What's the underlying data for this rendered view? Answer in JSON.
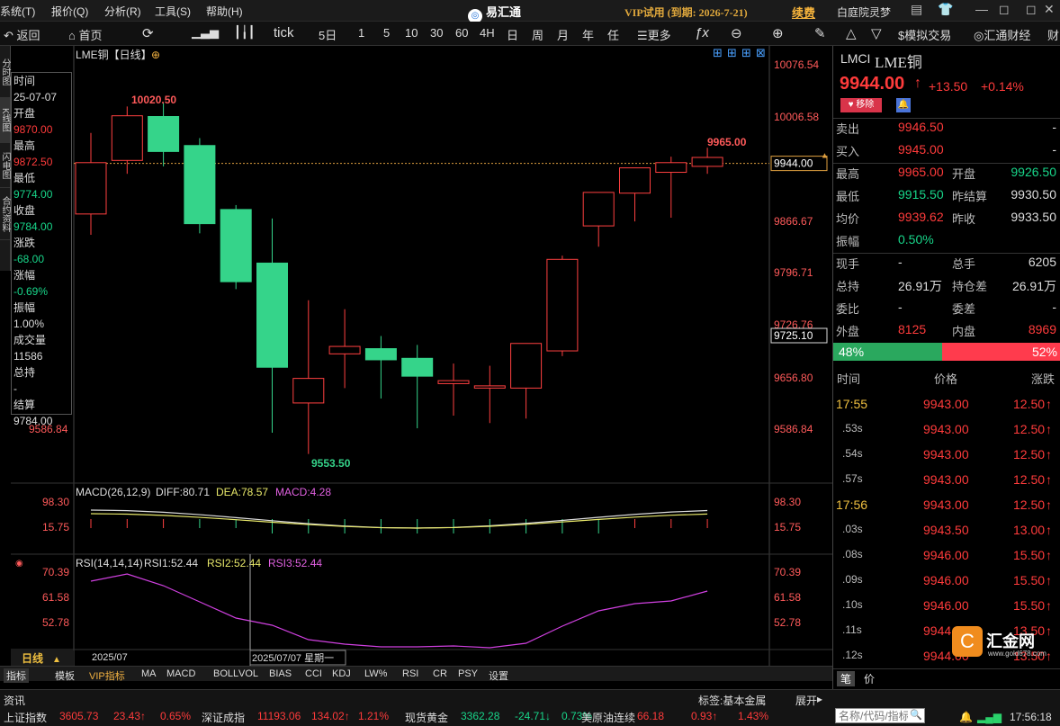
{
  "menu": {
    "items": [
      "系统(T)",
      "报价(Q)",
      "分析(R)",
      "工具(S)",
      "帮助(H)"
    ],
    "app_name": "易汇通",
    "vip_text": "VIP试用 (到期: 2026-7-21)",
    "renew": "续费",
    "user": "白庭院灵梦"
  },
  "toolbar": {
    "back": "返回",
    "home": "首页",
    "tick": "tick",
    "periods": [
      "5日",
      "1",
      "5",
      "10",
      "30",
      "60",
      "4H",
      "日",
      "周",
      "月",
      "年",
      "任"
    ],
    "more": "更多"
  },
  "right_toolbar": {
    "sim": "模拟交易",
    "news": "汇通财经",
    "more": "财"
  },
  "left_side": [
    "分时图",
    "K线图",
    "闪电图",
    "合约资料"
  ],
  "chart": {
    "title": "LME铜【日线】",
    "price_labels": [
      "10076.54",
      "10006.58",
      "9866.67",
      "9796.71",
      "9726.76",
      "9656.80",
      "9586.84"
    ],
    "left_low_label": "9586.84",
    "current_tag": "9944.00",
    "hover_tag": "9725.10",
    "max_label": "10020.50",
    "min_label": "9553.50",
    "recent_high_label": "9965.00"
  },
  "info_panel": [
    {
      "label": "时间",
      "value": "25-07-07",
      "vc": "#ddd"
    },
    {
      "label": "开盘",
      "value": "9870.00",
      "vc": "#ff3b3b"
    },
    {
      "label": "最高",
      "value": "9872.50",
      "vc": "#ff3b3b"
    },
    {
      "label": "最低",
      "value": "9774.00",
      "vc": "#18d68a"
    },
    {
      "label": "收盘",
      "value": "9784.00",
      "vc": "#18d68a"
    },
    {
      "label": "涨跌",
      "value": "-68.00",
      "vc": "#18d68a"
    },
    {
      "label": "涨幅",
      "value": "-0.69%",
      "vc": "#18d68a"
    },
    {
      "label": "振幅",
      "value": "1.00%",
      "vc": "#ddd"
    },
    {
      "label": "成交量",
      "value": "11586",
      "vc": "#ddd"
    },
    {
      "label": "总持",
      "value": "-",
      "vc": "#ddd"
    },
    {
      "label": "结算",
      "value": "9784.00",
      "vc": "#ddd"
    }
  ],
  "macd": {
    "title": "MACD(26,12,9)",
    "diff": "DIFF:80.71",
    "dea": "DEA:78.57",
    "macd": "MACD:4.28",
    "labels": [
      "98.30",
      "15.75"
    ]
  },
  "rsi": {
    "title": "RSI(14,14,14)",
    "rsi1": "RSI1:52.44",
    "rsi2": "RSI2:52.44",
    "rsi3": "RSI3:52.44",
    "labels": [
      "70.39",
      "61.58",
      "52.78"
    ]
  },
  "x_axis": {
    "period": "日线",
    "month": "2025/07",
    "cursor": "2025/07/07 星期一"
  },
  "bottom_tabs": [
    "指标",
    "模板",
    "VIP指标",
    "MA",
    "MACD",
    "BOLL",
    "VOL",
    "BIAS",
    "CCI",
    "KDJ",
    "LW%",
    "RSI",
    "CR",
    "PSY",
    "设置"
  ],
  "quote": {
    "symbol": "LMCI",
    "name": "LME铜",
    "price": "9944.00",
    "change": "+13.50",
    "pct": "+0.14%",
    "remove": "移除",
    "rows": [
      {
        "l1": "卖出",
        "v1": "9946.50",
        "c1": "red",
        "l2": "",
        "v2": "-",
        "c2": "wht"
      },
      {
        "l1": "买入",
        "v1": "9945.00",
        "c1": "red",
        "l2": "",
        "v2": "-",
        "c2": "wht"
      },
      {
        "l1": "最高",
        "v1": "9965.00",
        "c1": "red",
        "l2": "开盘",
        "v2": "9926.50",
        "c2": "grn"
      },
      {
        "l1": "最低",
        "v1": "9915.50",
        "c1": "grn",
        "l2": "昨结算",
        "v2": "9930.50",
        "c2": "wht"
      },
      {
        "l1": "均价",
        "v1": "9939.62",
        "c1": "red",
        "l2": "昨收",
        "v2": "9933.50",
        "c2": "wht"
      },
      {
        "l1": "振幅",
        "v1": "0.50%",
        "c1": "grn",
        "l2": "",
        "v2": "",
        "c2": "wht"
      },
      {
        "l1": "现手",
        "v1": "-",
        "c1": "wht",
        "l2": "总手",
        "v2": "6205",
        "c2": "wht"
      },
      {
        "l1": "总持",
        "v1": "26.91万",
        "c1": "wht",
        "l2": "持仓差",
        "v2": "26.91万",
        "c2": "wht"
      },
      {
        "l1": "委比",
        "v1": "-",
        "c1": "wht",
        "l2": "委差",
        "v2": "-",
        "c2": "wht"
      },
      {
        "l1": "外盘",
        "v1": "8125",
        "c1": "red",
        "l2": "内盘",
        "v2": "8969",
        "c2": "red"
      }
    ],
    "outer_pct": "48%",
    "inner_pct": "52%",
    "outer_frac": 0.48
  },
  "ticks": {
    "headers": [
      "时间",
      "价格",
      "涨跌"
    ],
    "rows": [
      {
        "t": "17:55",
        "p": "9943.00",
        "c": "12.50"
      },
      {
        "t": ".53s",
        "p": "9943.00",
        "c": "12.50"
      },
      {
        "t": ".54s",
        "p": "9943.00",
        "c": "12.50"
      },
      {
        "t": ".57s",
        "p": "9943.00",
        "c": "12.50"
      },
      {
        "t": "17:56",
        "p": "9943.00",
        "c": "12.50"
      },
      {
        "t": ".03s",
        "p": "9943.50",
        "c": "13.00"
      },
      {
        "t": ".08s",
        "p": "9946.00",
        "c": "15.50"
      },
      {
        "t": ".09s",
        "p": "9946.00",
        "c": "15.50"
      },
      {
        "t": ".10s",
        "p": "9946.00",
        "c": "15.50"
      },
      {
        "t": ".11s",
        "p": "9944.00",
        "c": "13.50"
      },
      {
        "t": ".12s",
        "p": "9944.00",
        "c": "13.50"
      }
    ]
  },
  "right_bottom": {
    "tab1": "笔",
    "tab2": "价",
    "search_placeholder": "名称/代码/指标",
    "brand": "汇金网",
    "brand_url": "www.gold678.com"
  },
  "statusbar": {
    "news": "资讯",
    "tag": "标签:基本金属",
    "expand": "展开",
    "clock": "17:56:18",
    "items": [
      {
        "name": "上证指数",
        "v": "3605.73",
        "c": "23.43↑",
        "p": "0.65%",
        "color": "#ff3b3b"
      },
      {
        "name": "深证成指",
        "v": "11193.06",
        "c": "134.02↑",
        "p": "1.21%",
        "color": "#ff3b3b"
      },
      {
        "name": "现货黄金",
        "v": "3362.28",
        "c": "-24.71↓",
        "p": "0.73%",
        "color": "#18d68a"
      },
      {
        "name": "美原油连续",
        "v": "66.18",
        "c": "0.93↑",
        "p": "1.43%",
        "color": "#ff3b3b"
      }
    ]
  },
  "candles": [
    {
      "o": 9876,
      "h": 9985,
      "l": 9848,
      "c": 9945
    },
    {
      "o": 9948,
      "h": 10020.5,
      "l": 9930,
      "c": 10008
    },
    {
      "o": 10007,
      "h": 10025,
      "l": 9940,
      "c": 9960
    },
    {
      "o": 9968,
      "h": 9978,
      "l": 9850,
      "c": 9863
    },
    {
      "o": 9882,
      "h": 9888,
      "l": 9775,
      "c": 9785
    },
    {
      "o": 9810,
      "h": 9870,
      "l": 9582,
      "c": 9670
    },
    {
      "o": 9622,
      "h": 9760,
      "l": 9553.5,
      "c": 9655
    },
    {
      "o": 9688,
      "h": 9748,
      "l": 9642,
      "c": 9698
    },
    {
      "o": 9695,
      "h": 9712,
      "l": 9628,
      "c": 9680
    },
    {
      "o": 9682,
      "h": 9700,
      "l": 9588,
      "c": 9658
    },
    {
      "o": 9648,
      "h": 9675,
      "l": 9605,
      "c": 9652
    },
    {
      "o": 9642,
      "h": 9672,
      "l": 9595,
      "c": 9645
    },
    {
      "o": 9642,
      "h": 9690,
      "l": 9601,
      "c": 9702
    },
    {
      "o": 9692,
      "h": 9820,
      "l": 9685,
      "c": 9815
    },
    {
      "o": 9860,
      "h": 9896,
      "l": 9832,
      "c": 9905
    },
    {
      "o": 9904,
      "h": 9930,
      "l": 9866,
      "c": 9938
    },
    {
      "o": 9932,
      "h": 9953,
      "l": 9871,
      "c": 9945
    },
    {
      "o": 9940,
      "h": 9965,
      "l": 9930,
      "c": 9952
    }
  ]
}
